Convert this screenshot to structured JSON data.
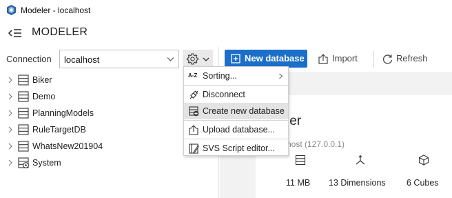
{
  "window": {
    "title": "Modeler - localhost"
  },
  "header": {
    "title": "MODELER"
  },
  "connection": {
    "label": "Connection",
    "value": "localhost"
  },
  "tree": {
    "items": [
      {
        "label": "Biker"
      },
      {
        "label": "Demo"
      },
      {
        "label": "PlanningModels"
      },
      {
        "label": "RuleTargetDB"
      },
      {
        "label": "WhatsNew201904"
      },
      {
        "label": "System"
      }
    ]
  },
  "toolbar": {
    "new_database_label": "New database",
    "import_label": "Import",
    "refresh_label": "Refresh"
  },
  "menu": {
    "sorting_icon_text": "A-Z",
    "items": [
      {
        "label": "Sorting..."
      },
      {
        "label": "Disconnect"
      },
      {
        "label": "Create new database"
      },
      {
        "label": "Upload database..."
      },
      {
        "label": "SVS Script editor..."
      }
    ]
  },
  "card": {
    "title_fragment": "ler",
    "host_fragment": "host (127.0.0.1)",
    "stats": [
      {
        "label": "11 MB",
        "icon": "database-icon"
      },
      {
        "label": "13 Dimensions",
        "icon": "dimensions-icon"
      },
      {
        "label": "6 Cubes",
        "icon": "cube-icon"
      }
    ]
  },
  "colors": {
    "accent": "#1b6fc9",
    "menu_hover": "#e3e3e3",
    "panel_bg": "#f2f2f2"
  }
}
